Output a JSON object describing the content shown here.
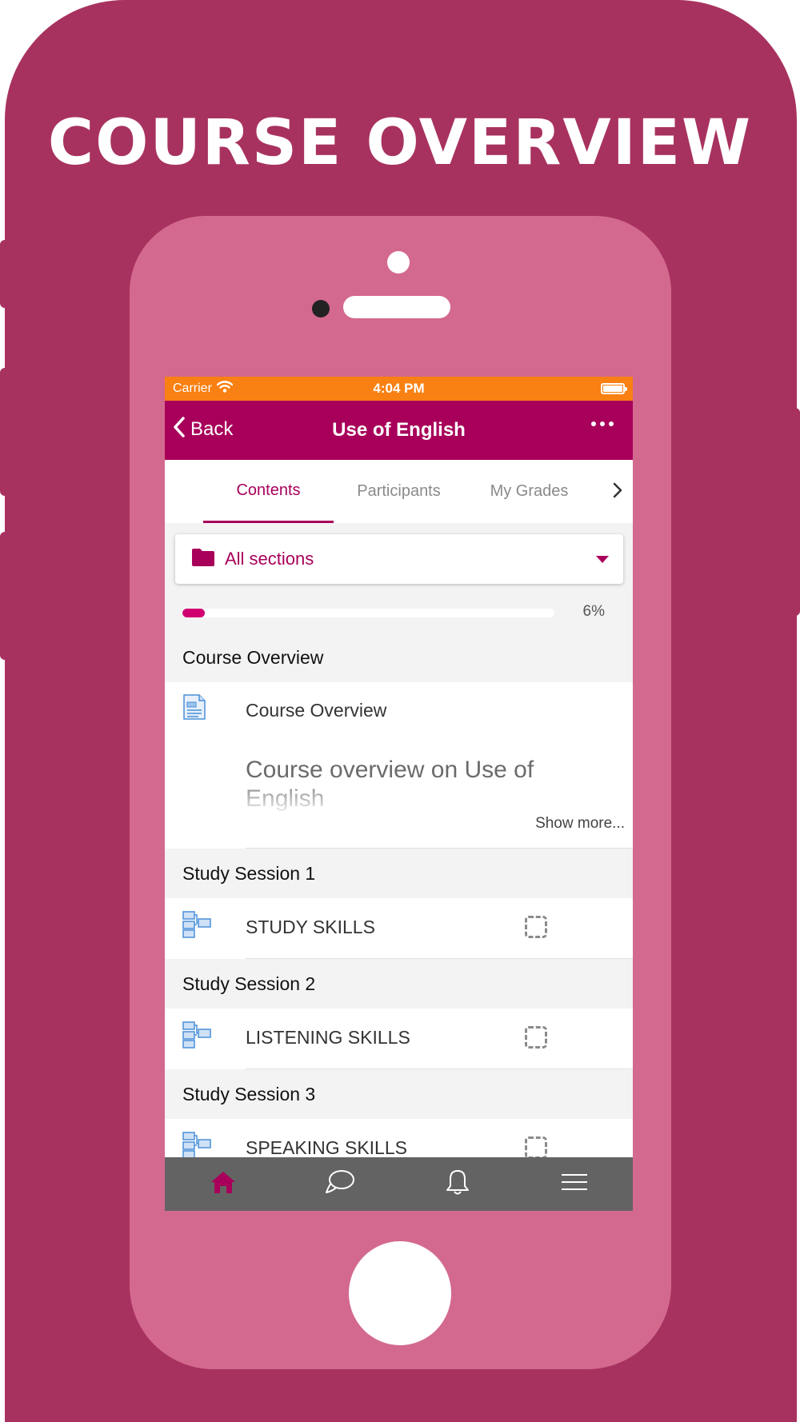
{
  "headline": "COURSE OVERVIEW",
  "status_bar": {
    "carrier": "Carrier",
    "time": "4:04 PM"
  },
  "navbar": {
    "back_label": "Back",
    "title": "Use of English"
  },
  "tabs": [
    {
      "label": "Contents",
      "active": true
    },
    {
      "label": "Participants",
      "active": false
    },
    {
      "label": "My Grades",
      "active": false
    }
  ],
  "section_selector": {
    "label": "All sections",
    "icon": "folder-icon"
  },
  "progress": {
    "value": 6,
    "label": "6%"
  },
  "sections": [
    {
      "title": "Course Overview",
      "modules": [
        {
          "name": "Course Overview",
          "icon": "page-icon",
          "summary": "Course overview on Use of English",
          "show_more": "Show more..."
        }
      ]
    },
    {
      "title": "Study Session 1",
      "modules": [
        {
          "name": "STUDY SKILLS",
          "icon": "lesson-icon"
        }
      ]
    },
    {
      "title": "Study Session 2",
      "modules": [
        {
          "name": "LISTENING SKILLS",
          "icon": "lesson-icon"
        }
      ]
    },
    {
      "title": "Study Session 3",
      "modules": [
        {
          "name": "SPEAKING SKILLS",
          "icon": "lesson-icon"
        }
      ]
    }
  ],
  "bottom_tabs": [
    {
      "icon": "home-icon",
      "active": true
    },
    {
      "icon": "chat-icon",
      "active": false
    },
    {
      "icon": "bell-icon",
      "active": false
    },
    {
      "icon": "menu-icon",
      "active": false
    }
  ],
  "colors": {
    "brand": "#a8005a",
    "status_bar": "#f98012",
    "outer_frame": "#a8325f",
    "inner_frame": "#d3698f",
    "tabbar": "#636363",
    "progress_fill": "#d10071"
  }
}
